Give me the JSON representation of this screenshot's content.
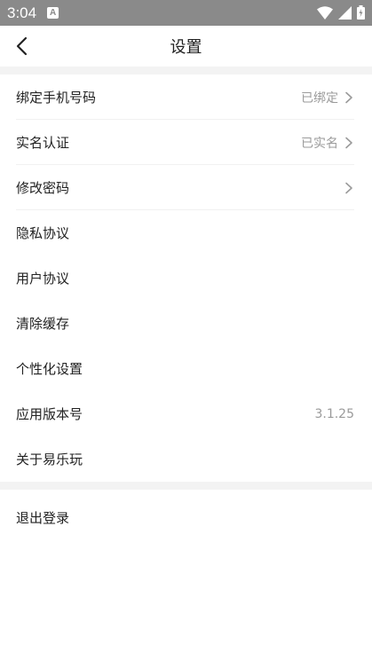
{
  "status_bar": {
    "time": "3:04",
    "notification_glyph": "A"
  },
  "header": {
    "title": "设置"
  },
  "settings_items": [
    {
      "label": "绑定手机号码",
      "value": "已绑定",
      "chevron": true
    },
    {
      "label": "实名认证",
      "value": "已实名",
      "chevron": true
    },
    {
      "label": "修改密码",
      "value": "",
      "chevron": true
    },
    {
      "label": "隐私协议",
      "value": "",
      "chevron": false
    },
    {
      "label": "用户协议",
      "value": "",
      "chevron": false
    },
    {
      "label": "清除缓存",
      "value": "",
      "chevron": false
    },
    {
      "label": "个性化设置",
      "value": "",
      "chevron": false
    },
    {
      "label": "应用版本号",
      "value": "3.1.25",
      "chevron": false
    },
    {
      "label": "关于易乐玩",
      "value": "",
      "chevron": false
    }
  ],
  "logout": {
    "label": "退出登录"
  },
  "colors": {
    "status_bar": "#8a8a8a",
    "section_gap": "#f3f3f3",
    "secondary_text": "#9a9a9a"
  },
  "icons": [
    "back-arrow-icon",
    "wifi-icon",
    "signal-icon",
    "battery-icon",
    "chevron-right-icon"
  ]
}
